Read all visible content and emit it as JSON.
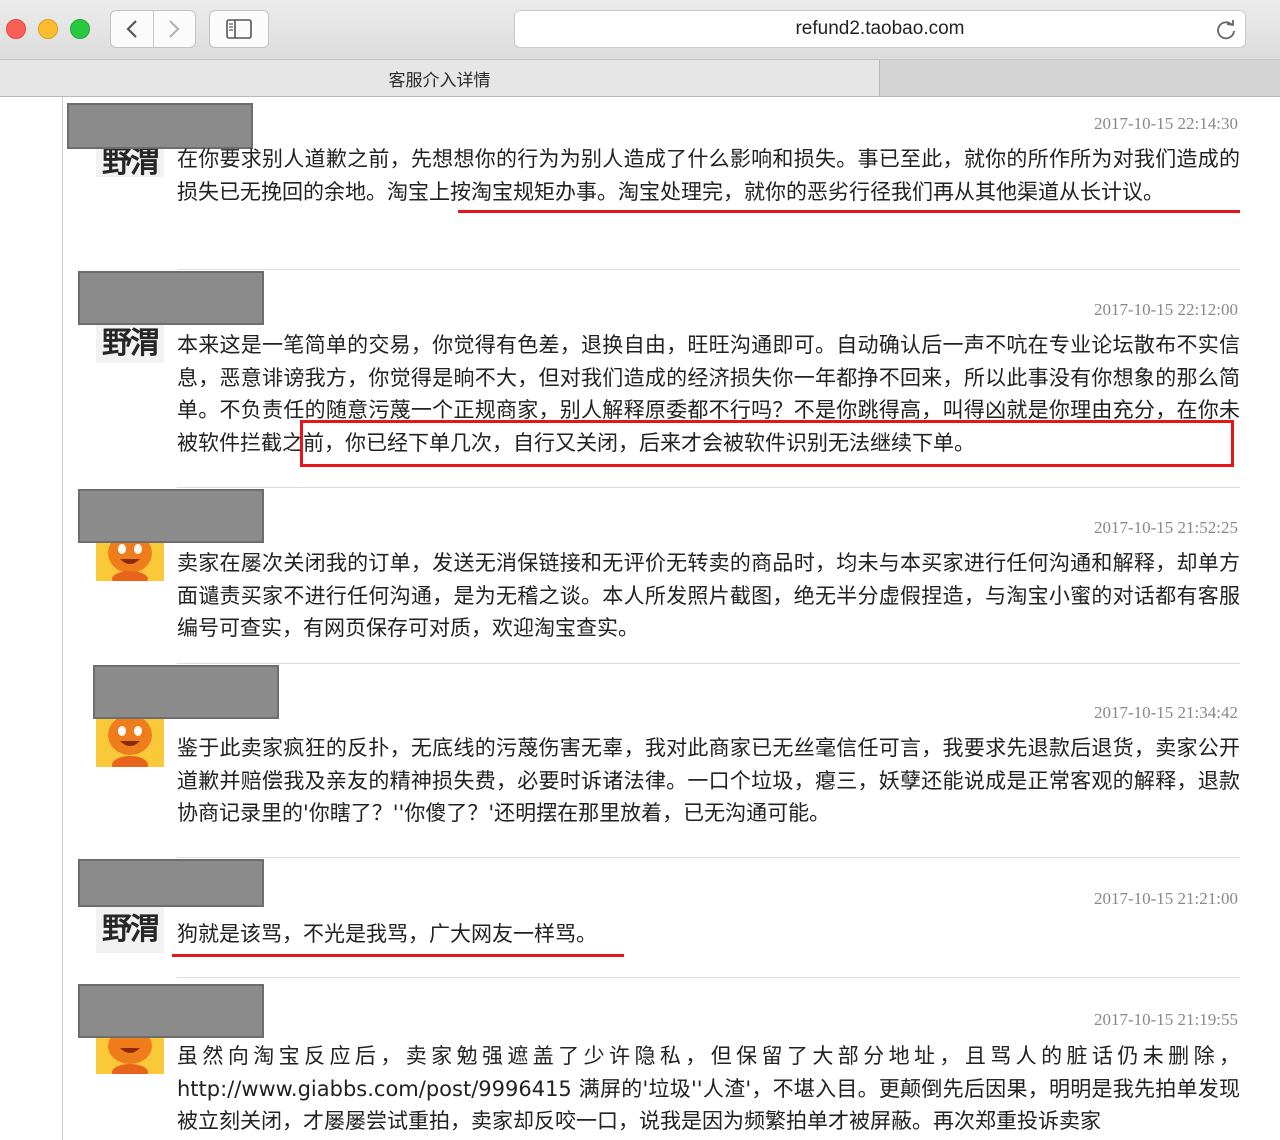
{
  "browser": {
    "url": "refund2.taobao.com",
    "tab_title": "客服介入详情"
  },
  "messages": [
    {
      "timestamp": "2017-10-15 22:14:30",
      "avatar": "seal-avatar",
      "text": "在你要求别人道歉之前，先想想你的行为为别人造成了什么影响和损失。事已至此，就你的所作所为对我们造成的损失已无挽回的余地。淘宝上按淘宝规矩办事。淘宝处理完，就你的恶劣行径我们再从其他渠道从长计议。"
    },
    {
      "timestamp": "2017-10-15 22:12:00",
      "avatar": "seal-avatar",
      "text": "本来这是一笔简单的交易，你觉得有色差，退换自由，旺旺沟通即可。自动确认后一声不吭在专业论坛散布不实信息，恶意诽谤我方，你觉得是晌不大，但对我们造成的经济损失你一年都挣不回来，所以此事没有你想象的那么简单。不负责任的随意污蔑一个正规商家，别人解释原委都不行吗？不是你跳得高，叫得凶就是你理由充分，在你未被软件拦截之前，你已经下单几次，自行又关闭，后来才会被软件识别无法继续下单。"
    },
    {
      "timestamp": "2017-10-15 21:52:25",
      "avatar": "cartoon-avatar",
      "text": "卖家在屡次关闭我的订单，发送无消保链接和无评价无转卖的商品时，均未与本买家进行任何沟通和解释，却单方面谴责买家不进行任何沟通，是为无稽之谈。本人所发照片截图，绝无半分虚假捏造，与淘宝小蜜的对话都有客服编号可查实，有网页保存可对质，欢迎淘宝查实。"
    },
    {
      "timestamp": "2017-10-15 21:34:42",
      "avatar": "cartoon-avatar",
      "text": "鉴于此卖家疯狂的反扑，无底线的污蔑伤害无辜，我对此商家已无丝毫信任可言，我要求先退款后退货，卖家公开道歉并赔偿我及亲友的精神损失费，必要时诉诸法律。一口个垃圾，瘪三，妖孽还能说成是正常客观的解释，退款协商记录里的'你瞎了？''你傻了？'还明摆在那里放着，已无沟通可能。"
    },
    {
      "timestamp": "2017-10-15 21:21:00",
      "avatar": "seal-avatar",
      "text": "狗就是该骂，不光是我骂，广大网友一样骂。"
    },
    {
      "timestamp": "2017-10-15 21:19:55",
      "avatar": "cartoon-avatar",
      "text": "虽然向淘宝反应后，卖家勉强遮盖了少许隐私，但保留了大部分地址，且骂人的脏话仍未删除， http://www.giabbs.com/post/9996415 满屏的'垃圾''人渣'，不堪入目。更颠倒先后因果，明明是我先拍单发现被立刻关闭，才屡屡尝试重拍，卖家却反咬一口，说我是因为频繁拍单才被屏蔽。再次郑重投诉卖家"
    }
  ]
}
